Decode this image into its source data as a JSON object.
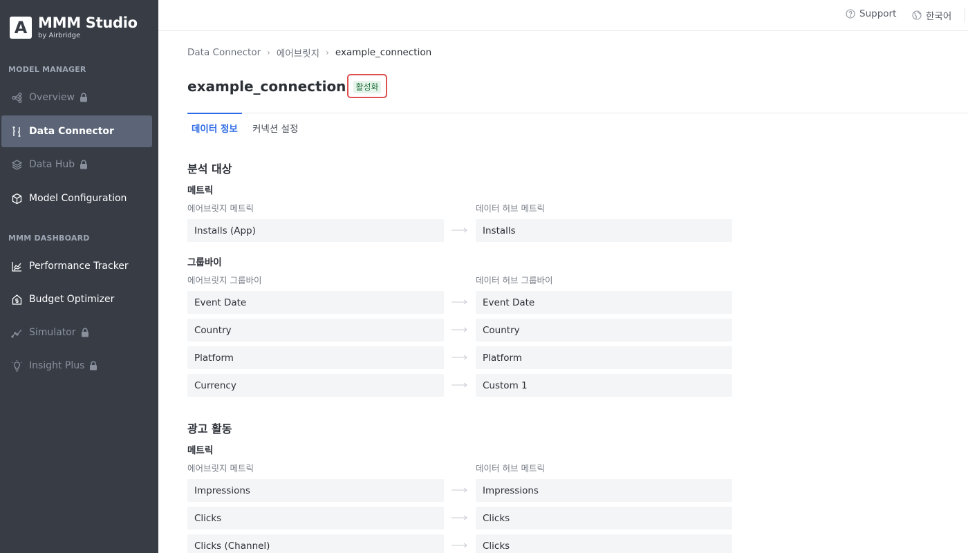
{
  "brand": {
    "mark": "A",
    "title": "MMM Studio",
    "subtitle": "by Airbridge"
  },
  "sidebar": {
    "sections": [
      {
        "label": "MODEL MANAGER"
      },
      {
        "label": "MMM DASHBOARD"
      }
    ],
    "items": [
      {
        "label": "Overview",
        "icon": "flow-icon",
        "locked": true
      },
      {
        "label": "Data Connector",
        "icon": "connector-icon",
        "active": true
      },
      {
        "label": "Data Hub",
        "icon": "layers-icon",
        "locked": true
      },
      {
        "label": "Model Configuration",
        "icon": "cube-icon"
      },
      {
        "label": "Performance Tracker",
        "icon": "chart-icon"
      },
      {
        "label": "Budget Optimizer",
        "icon": "house-dollar-icon"
      },
      {
        "label": "Simulator",
        "icon": "trend-icon",
        "locked": true
      },
      {
        "label": "Insight Plus",
        "icon": "bulb-icon",
        "locked": true
      }
    ]
  },
  "topbar": {
    "support": "Support",
    "language": "한국어"
  },
  "breadcrumb": [
    "Data Connector",
    "에어브릿지",
    "example_connection"
  ],
  "page": {
    "title": "example_connection",
    "status": "활성화"
  },
  "tabs": [
    {
      "label": "데이터 정보",
      "active": true
    },
    {
      "label": "커넥션 설정",
      "active": false
    }
  ],
  "sections": [
    {
      "title": "분석 대상",
      "metrics": {
        "title": "메트릭",
        "left_header": "에어브릿지 메트릭",
        "right_header": "데이터 허브 메트릭",
        "rows": [
          {
            "source": "Installs (App)",
            "target": "Installs"
          }
        ]
      },
      "groupby": {
        "title": "그룹바이",
        "left_header": "에어브릿지 그룹바이",
        "right_header": "데이터 허브 그룹바이",
        "rows": [
          {
            "source": "Event Date",
            "target": "Event Date"
          },
          {
            "source": "Country",
            "target": "Country"
          },
          {
            "source": "Platform",
            "target": "Platform"
          },
          {
            "source": "Currency",
            "target": "Custom 1"
          }
        ]
      }
    },
    {
      "title": "광고 활동",
      "metrics": {
        "title": "메트릭",
        "left_header": "에어브릿지 메트릭",
        "right_header": "데이터 허브 메트릭",
        "rows": [
          {
            "source": "Impressions",
            "target": "Impressions"
          },
          {
            "source": "Clicks",
            "target": "Clicks"
          },
          {
            "source": "Clicks (Channel)",
            "target": "Clicks"
          }
        ]
      }
    }
  ],
  "colors": {
    "sidebar_bg": "#373c45",
    "sidebar_active": "#5b6577",
    "accent": "#2e6be6",
    "badge_bg": "#e6f5eb",
    "badge_text": "#1f6f3a",
    "highlight_border": "#e04f50"
  }
}
